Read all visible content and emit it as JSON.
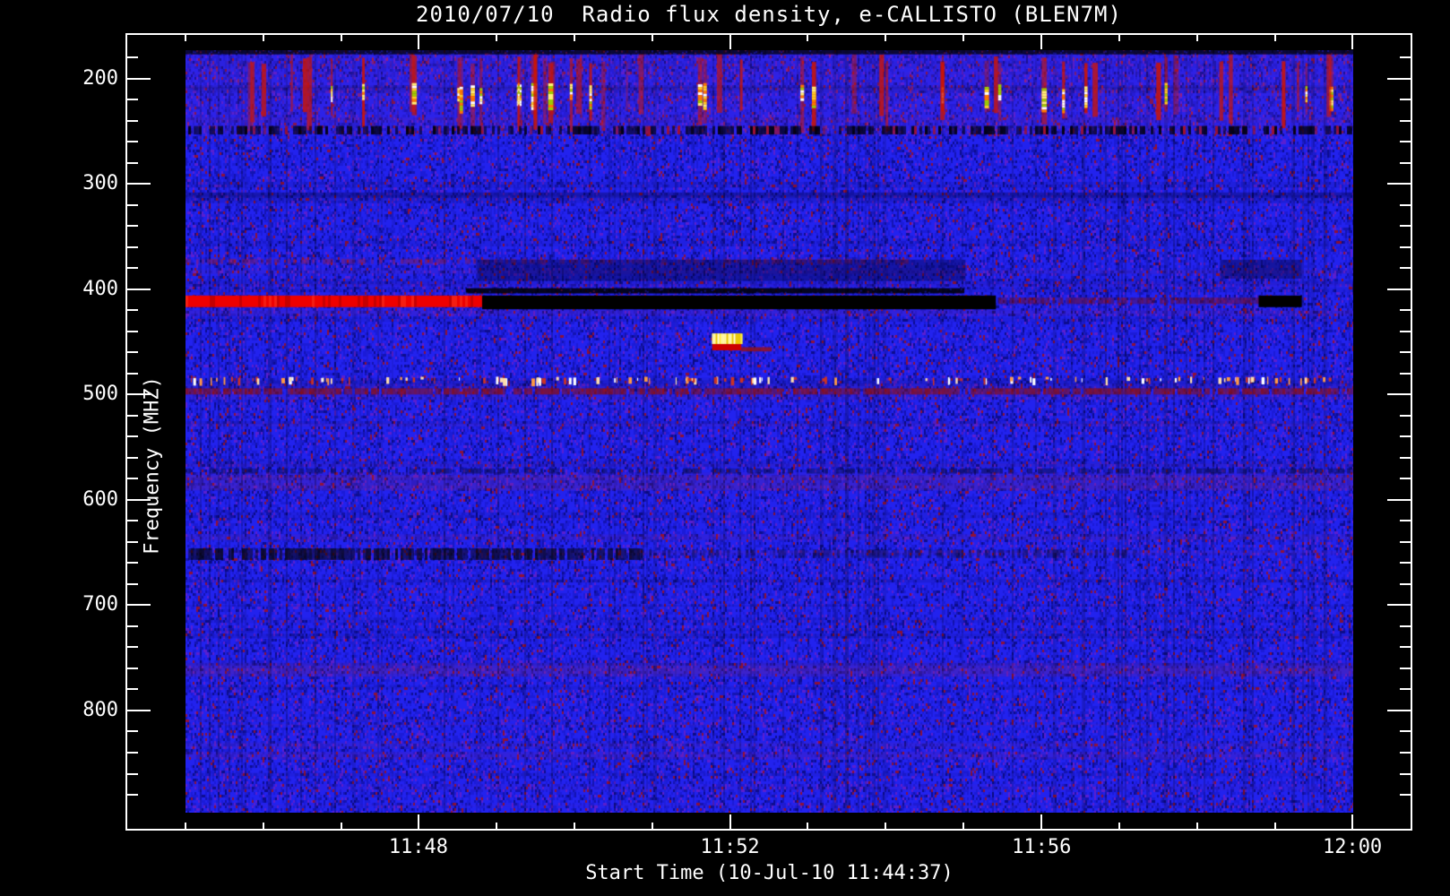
{
  "title": "2010/07/10  Radio flux density, e-CALLISTO (BLEN7M)",
  "x_axis": {
    "label": "Start Time (10-Jul-10 11:44:37)",
    "major_ticks": [
      {
        "label": "11:48",
        "frac": 0.1995
      },
      {
        "label": "11:52",
        "frac": 0.4663
      },
      {
        "label": "11:56",
        "frac": 0.7331
      },
      {
        "label": "12:00",
        "frac": 0.9993
      }
    ],
    "minor_tick_fracs": [
      0.0,
      0.0666,
      0.1332,
      0.2662,
      0.3328,
      0.3995,
      0.533,
      0.5997,
      0.6664,
      0.7998,
      0.8665,
      0.9331
    ]
  },
  "y_axis": {
    "label": "Frequency (MHZ)",
    "major_ticks": [
      200,
      300,
      400,
      500,
      600,
      700,
      800
    ],
    "minor_ticks": [
      180,
      220,
      240,
      260,
      280,
      320,
      340,
      360,
      380,
      420,
      440,
      460,
      480,
      520,
      540,
      560,
      580,
      620,
      640,
      660,
      680,
      720,
      740,
      760,
      780,
      820,
      840,
      860,
      880
    ]
  },
  "chart_data": {
    "type": "heatmap",
    "title": "2010/07/10  Radio flux density, e-CALLISTO (BLEN7M)",
    "xlabel": "Start Time (10-Jul-10 11:44:37)",
    "ylabel": "Frequency (MHZ)",
    "x_range_time": [
      "11:44:37",
      "12:00:00"
    ],
    "y_range_mhz": [
      173,
      897
    ],
    "grid": false,
    "legend": "none",
    "palette": {
      "base": "#2222ee",
      "base2": "#1b1bd8",
      "dark": "#1414b2",
      "purple": "#5a1fd0",
      "deep": "#0d0d90",
      "red_speck": "#8e1238"
    },
    "features": [
      {
        "type": "topband",
        "desc": "strong bursty RFI band 173-253 MHz with vertical red streaks and saturated white/yellow cores near 205-230 MHz",
        "f0": 173,
        "f1": 253,
        "tint": "#6a28c8",
        "tint_alpha": 0.15,
        "streaks": 58,
        "streak_color": "#cc1505",
        "core_prob": 0.62,
        "core_f0": 204,
        "core_f1": 228,
        "core_colors": [
          "#ffffff",
          "#ffee77",
          "#ffcc22",
          "#ff7700",
          "#9ccc00"
        ],
        "dark_row_f": [
          245,
          253
        ]
      },
      {
        "type": "black_band",
        "desc": "dark first channel row",
        "f0": 172,
        "f1": 177,
        "t0": 0,
        "t1": 1,
        "alpha": 0.75,
        "speckle": 0.35
      },
      {
        "type": "speckle_line",
        "desc": "weak red interference line ~373 MHz on left half",
        "f0": 371,
        "f1": 376,
        "t0": 0,
        "t1": 0.62,
        "color": "#aa1828",
        "alpha": 0.45,
        "density": 0.55
      },
      {
        "type": "tint_band",
        "desc": "darkened band 372-392 MHz during saturated interval",
        "f0": 372,
        "f1": 392,
        "t0": 0.25,
        "t1": 0.668,
        "color": "#000033",
        "alpha": 0.38
      },
      {
        "type": "black_band",
        "desc": "thin black line ~400 MHz",
        "f0": 399,
        "f1": 404,
        "t0": 0.24,
        "t1": 0.667,
        "alpha": 0.85,
        "speckle": 0.25
      },
      {
        "type": "hline",
        "desc": "bright red carrier ~410 MHz from start until ~11:49",
        "f0": 406,
        "f1": 417,
        "t0": 0,
        "t1": 0.254,
        "color": "#ee0000"
      },
      {
        "type": "black_band",
        "desc": "saturated black band ~406-419 MHz 11:49-11:55.4",
        "f0": 406,
        "f1": 419,
        "t0": 0.254,
        "t1": 0.694,
        "alpha": 1,
        "speckle": 0
      },
      {
        "type": "speckle_line",
        "desc": "dark red continuation of 410 MHz carrier",
        "f0": 408,
        "f1": 414,
        "t0": 0.694,
        "t1": 0.919,
        "color": "#7a0a12",
        "alpha": 0.6,
        "density": 0.85
      },
      {
        "type": "tint_band",
        "desc": "dark band 372-390 MHz far right",
        "f0": 372,
        "f1": 390,
        "t0": 0.886,
        "t1": 0.956,
        "color": "#000022",
        "alpha": 0.38
      },
      {
        "type": "black_band",
        "desc": "short black segment ~410 MHz near 11:59",
        "f0": 406,
        "f1": 417,
        "t0": 0.919,
        "t1": 0.956,
        "alpha": 1,
        "speckle": 0
      },
      {
        "type": "blob",
        "desc": "bright yellow burst ~445 MHz at ~11:52",
        "t0": 0.451,
        "t1": 0.476,
        "f0": 442,
        "f1": 452,
        "colors": [
          "#fff9b0",
          "#ffee44",
          "#e8c400",
          "#fffbe0"
        ],
        "under_color": "#cc0000",
        "under_f1": 458,
        "tail_f0": 455,
        "tail_f1": 459,
        "tail_t1": 0.502,
        "tail_color": "#991111"
      },
      {
        "type": "rfi_ticks",
        "desc": "sparse white/orange RFI dashes ~485 MHz",
        "f0": 483,
        "f1": 489,
        "count": 130,
        "colors": [
          "#ffffff",
          "#ffddaa",
          "#ff9944",
          "#cc3322"
        ]
      },
      {
        "type": "speckle_line",
        "desc": "dark red interference line ~497 MHz full width",
        "f0": 494,
        "f1": 500,
        "t0": 0,
        "t1": 1,
        "color": "#8a0e16",
        "alpha": 0.85,
        "density": 0.9
      },
      {
        "type": "tint_band",
        "desc": "faint dark line ~310 MHz",
        "f0": 308,
        "f1": 312,
        "t0": 0,
        "t1": 1,
        "color": "#000030",
        "alpha": 0.22
      },
      {
        "type": "speckle_line",
        "desc": "dark speckled line ~572 MHz",
        "f0": 570,
        "f1": 575,
        "t0": 0,
        "t1": 1,
        "color": "#0a0a30",
        "alpha": 0.55,
        "density": 0.6
      },
      {
        "type": "tint_band",
        "desc": "reddish band ~578-590 MHz",
        "f0": 577,
        "f1": 591,
        "t0": 0,
        "t1": 1,
        "color": "#a02848",
        "alpha": 0.15
      },
      {
        "type": "speckle_line",
        "desc": "black absorption-like band ~650 MHz strong on left",
        "f0": 646,
        "f1": 657,
        "t0": 0,
        "t1": 0.39,
        "color": "#05050a",
        "alpha": 0.8,
        "density": 0.75
      },
      {
        "type": "speckle_line",
        "desc": "black band ~650 MHz weaker on right",
        "f0": 647,
        "f1": 655,
        "t0": 0.39,
        "t1": 0.82,
        "color": "#0a0a18",
        "alpha": 0.45,
        "density": 0.5
      },
      {
        "type": "tint_band",
        "desc": "faint red band ~760 MHz",
        "f0": 756,
        "f1": 768,
        "t0": 0,
        "t1": 1,
        "color": "#a02848",
        "alpha": 0.13
      }
    ]
  }
}
